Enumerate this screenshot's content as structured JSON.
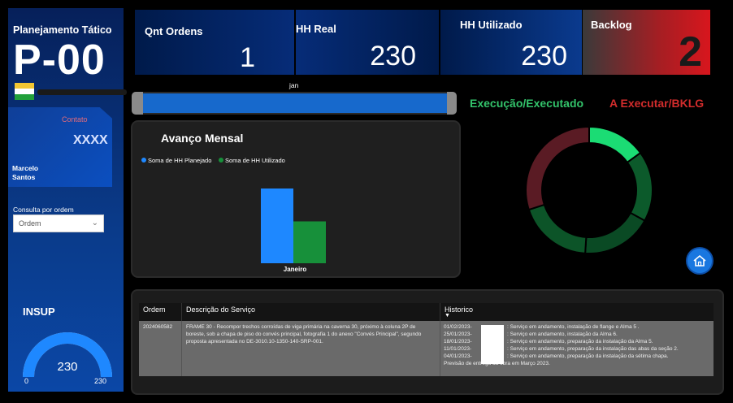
{
  "sidebar": {
    "title": "Planejamento Tático",
    "code": "P-00",
    "flag_colors": [
      "#f3c632",
      "#ffffff",
      "#21a03a"
    ],
    "contact": {
      "label": "Contato",
      "value": "XXXX",
      "name_line1": "Marcelo",
      "name_line2": "Santos"
    },
    "consulta": {
      "label": "Consulta por ordem",
      "placeholder": "Ordem"
    },
    "gauge": {
      "title": "INSUP",
      "value": "230",
      "min": "0",
      "max": "230",
      "fraction": 1.0,
      "color": "#1e88ff"
    }
  },
  "kpis": {
    "ordens": {
      "title": "Qnt Ordens",
      "value": "1"
    },
    "hh_real": {
      "title": "HH Real",
      "value": "230"
    },
    "hh_utilizado": {
      "title": "HH Utilizado",
      "value": "230"
    },
    "backlog": {
      "title": "Backlog",
      "value": "2"
    }
  },
  "month_slider": {
    "label": "jan"
  },
  "chart_data": {
    "type": "bar",
    "title": "Avanço Mensal",
    "categories": [
      "Janeiro"
    ],
    "series": [
      {
        "name": "Soma de HH Planejado",
        "color": "#1e88ff",
        "values": [
          100
        ]
      },
      {
        "name": "Soma de HH Utilizado",
        "color": "#17903a",
        "values": [
          56
        ]
      }
    ],
    "ylim": [
      0,
      100
    ]
  },
  "donut": {
    "labels": {
      "executed": "Execução/Executado",
      "backlog": "A Executar/BKLG"
    },
    "slices": [
      {
        "value": 15,
        "color": "#1bdc74"
      },
      {
        "value": 18,
        "color": "#0c5a2b"
      },
      {
        "value": 18,
        "color": "#0a4a24"
      },
      {
        "value": 19,
        "color": "#0c5428"
      },
      {
        "value": 30,
        "color": "#5a1b24"
      }
    ]
  },
  "table": {
    "headers": [
      "Ordem",
      "Descrição do Serviço",
      "Historico"
    ],
    "row": {
      "ordem": "2024060582",
      "descricao": "FRAME 30 - Recompor trechos corroídas de viga primária na caverna 30, próximo à coluna 2P de boreste, sob a chapa de piso do convés principal, fotografia 1 do anexo \"Convés Principal\", segundo proposta apresentada no DE-3010.10-1350-140-SRP-001.",
      "historico": [
        {
          "date": "01/02/2023-",
          "text": ": Serviço em andamento, instalação de flange e Alma 5 ."
        },
        {
          "date": "25/01/2023-",
          "text": ": Serviço em andamento, instalação da Alma 6."
        },
        {
          "date": "18/01/2023-",
          "text": ": Serviço em andamento, preparação da instalação da Alma 5."
        },
        {
          "date": "11/01/2023-",
          "text": ": Serviço em andamento, preparação da instalação das abas da seção 2."
        },
        {
          "date": "04/01/2023-",
          "text": ": Serviço em andamento, preparação da instalação da sétima chapa."
        }
      ],
      "previsao": "Previsão de entrega da obra em Março 2023."
    }
  }
}
